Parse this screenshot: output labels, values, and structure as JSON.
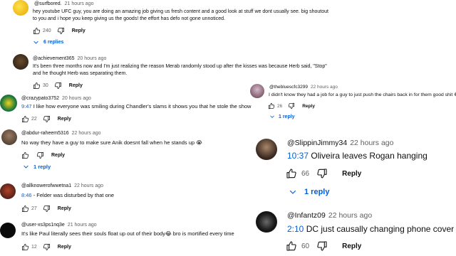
{
  "reply_label": "Reply",
  "comments": [
    {
      "handle": "@surfbored.",
      "time": "21 hours ago",
      "text_line1": "hey youtube UFC guy, you are doing an amazing job giving us fresh content and a good look at stuff we dont usually see. big shoutout",
      "text_line2": "to you and i hope you keep giving us the goods! the effort has defo not gone unnoticed.",
      "likes": "240",
      "replies": "6 replies"
    },
    {
      "handle": "@achievement365",
      "time": "20 hours ago",
      "text_line1": "It's been three months now and I'm just realizing the reason Merab randomly stood up after the kisses was because Herb said, \"Stop\"",
      "text_line2": "and he thought Herb was separating them.",
      "likes": "30"
    },
    {
      "handle": "@crazypato3752",
      "time": "20 hours ago",
      "timestamp": "9:47",
      "text": "I like how everyone was smiling during Chandler's slams it shows you that he stole the show",
      "likes": "22"
    },
    {
      "handle": "@abdur-raheem5316",
      "time": "22 hours ago",
      "text": "No way they have a guy to make sure Anik doesnt fall when he stands up",
      "emoji": "😭",
      "replies": "1 reply"
    },
    {
      "handle": "@allknowerofwwetna1",
      "time": "22 hours ago",
      "timestamp": "8:46",
      "text": " - Felder was disturbed by that one",
      "likes": "27"
    },
    {
      "handle": "@user-xs3ps1nq3e",
      "time": "21 hours ago",
      "text_a": "It's like Paul literally sees their souls float up out of their body",
      "emoji": "😂",
      "text_b": " bro is mortified every time",
      "likes": "12"
    },
    {
      "handle": "@thebluescfc3299",
      "time": "22 hours ago",
      "text": "I didn't know they had a job for a guy to just push the chairs back in for them good shit",
      "emoji": "😂",
      "likes": "26",
      "replies": "1 reply"
    },
    {
      "handle": "@SlippinJimmy34",
      "time": "22 hours ago",
      "timestamp": "10:37",
      "text": " Oliveira leaves Rogan hanging",
      "likes": "66",
      "replies": "1 reply"
    },
    {
      "handle": "@Infantz09",
      "time": "22 hours ago",
      "timestamp": "2:10",
      "text": " DC just causally changing phone cover lol",
      "likes": "60"
    }
  ]
}
